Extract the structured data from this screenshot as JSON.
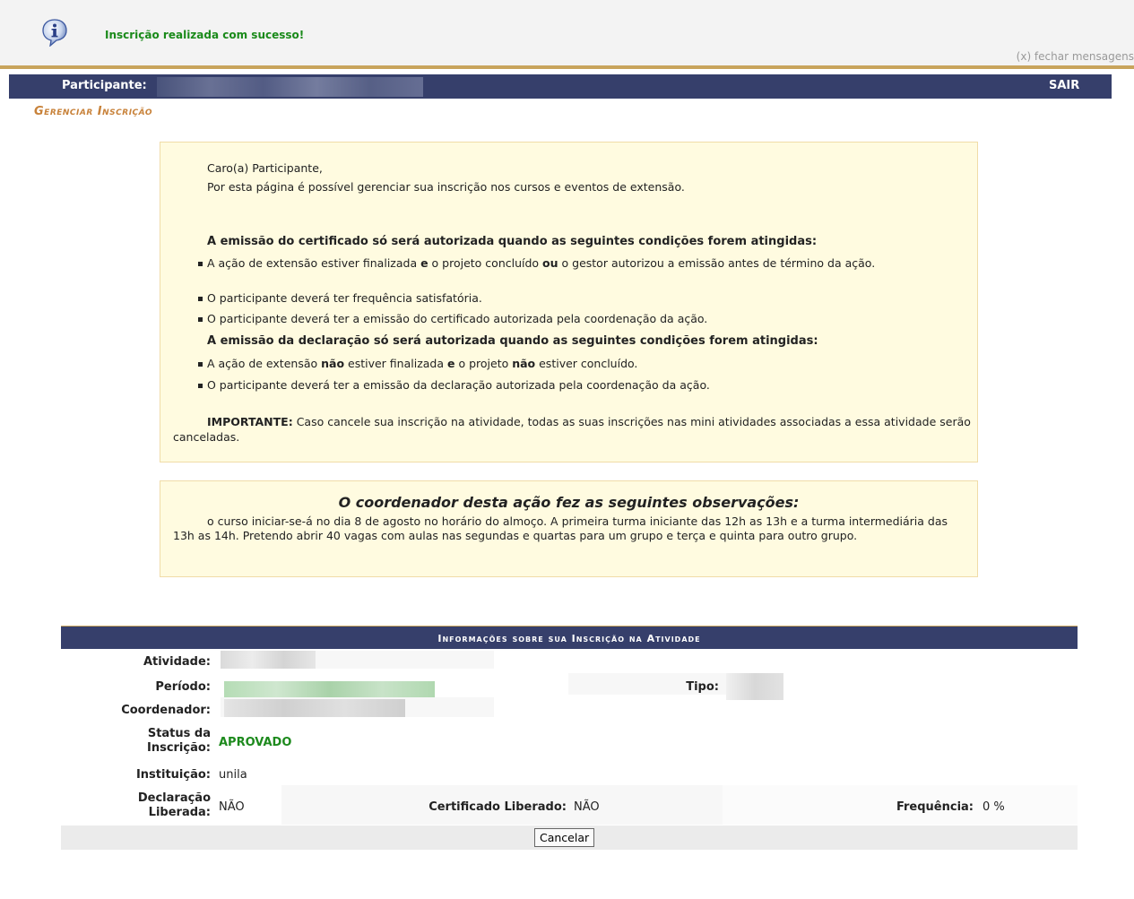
{
  "message": {
    "text": "Inscrição realizada com sucesso!",
    "close_label": "(x) fechar mensagens",
    "icon": "info-icon"
  },
  "nav": {
    "participant_label": "Participante:",
    "logout_label": "SAIR"
  },
  "page": {
    "heading": "Gerenciar Inscrição"
  },
  "notice": {
    "greeting": "Caro(a) Participante,",
    "intro": "Por esta página é possível gerenciar sua inscrição nos cursos e eventos de extensão.",
    "certificate_heading": "A emissão do certificado só será autorizada quando as seguintes condições forem atingidas:",
    "certificate_conditions": [
      "A ação de extensão estiver finalizada e o projeto concluído ou o gestor autorizou a emissão antes de término da ação.",
      "O participante deverá ter frequência satisfatória.",
      "O participante deverá ter a emissão do certificado autorizada pela coordenação da ação."
    ],
    "declaration_heading": "A emissão da declaração só será autorizada quando as seguintes condições forem atingidas:",
    "declaration_conditions": [
      "A ação de extensão não estiver finalizada e o projeto não estiver concluído.",
      "O participante deverá ter a emissão da declaração autorizada pela coordenação da ação."
    ],
    "important_label": "IMPORTANTE:",
    "important_text": "Caso cancele sua inscrição na atividade, todas as suas inscrições nas mini atividades associadas a essa atividade serão canceladas."
  },
  "observations": {
    "title": "O coordenador desta ação fez as seguintes observações:",
    "text": "o curso iniciar-se-á no dia 8 de agosto no horário do almoço. A primeira turma iniciante das 12h as 13h e a turma intermediária das 13h as 14h. Pretendo abrir 40 vagas com aulas nas segundas e quartas para um grupo e terça e quinta para outro grupo."
  },
  "info": {
    "caption": "Informações sobre sua Inscrição na Atividade",
    "labels": {
      "activity": "Atividade:",
      "period": "Período:",
      "type": "Tipo:",
      "coordinator": "Coordenador:",
      "status": "Status da Inscrição:",
      "institution": "Instituição:",
      "declaration": "Declaração Liberada:",
      "certificate": "Certificado Liberado:",
      "frequency": "Frequência:"
    },
    "values": {
      "status": "APROVADO",
      "institution": "unila",
      "declaration": "NÃO",
      "certificate": "NÃO",
      "frequency": "0 %"
    },
    "cancel_label": "Cancelar"
  },
  "colors": {
    "nav_bg": "#363f6b",
    "accent_gold": "#c8a45c",
    "heading_orange": "#c8823a",
    "success_green": "#1a8a1a",
    "notice_bg": "#fffbe0"
  }
}
